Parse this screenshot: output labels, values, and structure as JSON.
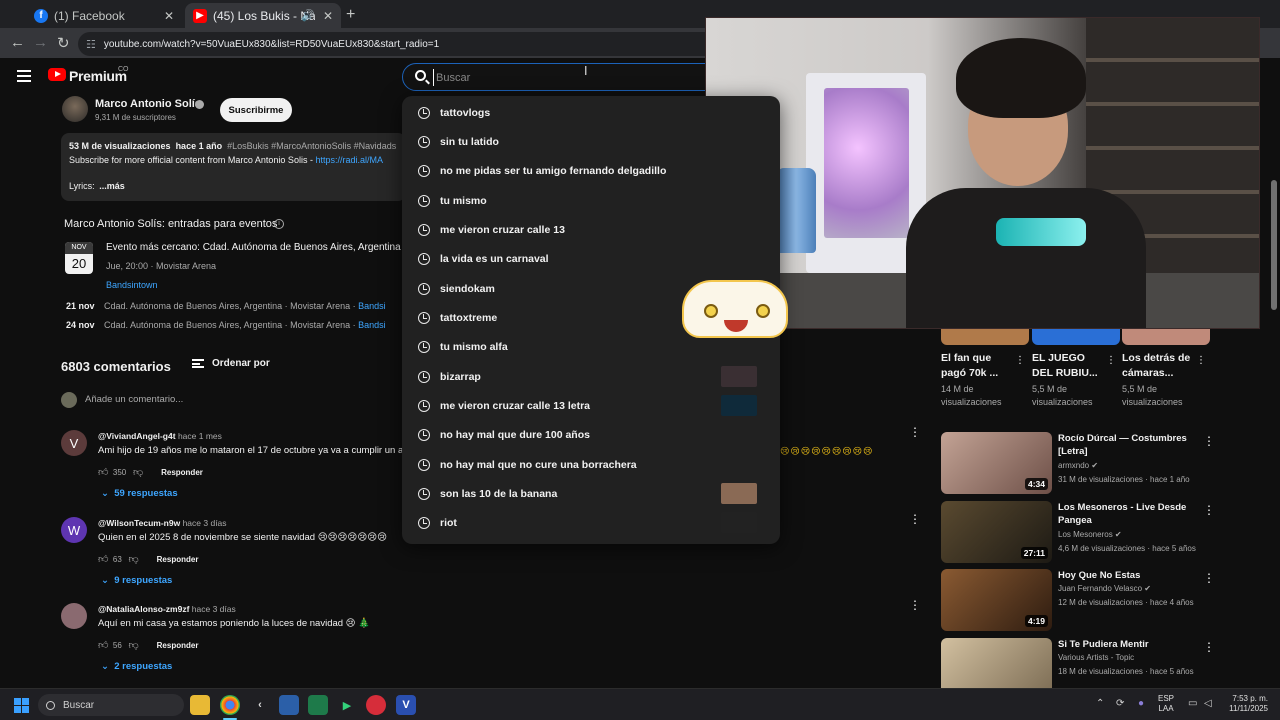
{
  "browser": {
    "tabs": [
      {
        "label": "(1) Facebook",
        "favicon": "facebook-icon",
        "active": false
      },
      {
        "label": "(45) Los Bukis - Navidad sin",
        "favicon": "youtube-icon",
        "active": true
      }
    ],
    "url": "youtube.com/watch?v=50VuaEUx830&list=RD50VuaEUx830&start_radio=1"
  },
  "youtube": {
    "brand": "Premium",
    "country_code": "CO",
    "search": {
      "placeholder": "Buscar",
      "value": ""
    },
    "accent": "#ff0000",
    "link_color": "#3ea6ff"
  },
  "channel": {
    "name": "Marco Antonio Solís",
    "subscribers": "9,31 M de suscriptores",
    "subscribe_label": "Suscribirme"
  },
  "description": {
    "views": "53 M de visualizaciones",
    "age": "hace 1 año",
    "hashtags": "#LosBukis #MarcoAntonioSolis #Navidads",
    "line2_prefix": "Subscribe for more official content from Marco Antonio Solis - ",
    "line2_link": "https://radi.al/MA",
    "lyrics": "Lyrics:",
    "more": "...más"
  },
  "events": {
    "title": "Marco Antonio Solís: entradas para eventos",
    "featured": {
      "month": "NOV",
      "day": "20",
      "name": "Evento más cercano: Cdad. Autónoma de Buenos Aires, Argentina",
      "time": "Jue, 20:00 · Movistar Arena",
      "source": "Bandsintown"
    },
    "rows": [
      {
        "date": "21 nov",
        "place": "Cdad. Autónoma de Buenos Aires, Argentina · Movistar Arena · ",
        "source": "Bandsi"
      },
      {
        "date": "24 nov",
        "place": "Cdad. Autónoma de Buenos Aires, Argentina · Movistar Arena · ",
        "source": "Bandsi"
      }
    ]
  },
  "comments_section": {
    "count": "6803 comentarios",
    "sort_label": "Ordenar por",
    "add_placeholder": "Añade un comentario...",
    "reply_label": "Responder",
    "items": [
      {
        "initial": "V",
        "avatar_color": "#5c3b3b",
        "handle": "@ViviandAngel-g4t",
        "ago": "hace 1 mes",
        "text": "Ami hijo de 19 años me lo mataron el 17 de octubre ya va a cumplir un añ",
        "likes": "350",
        "replies": "59 respuestas"
      },
      {
        "initial": "W",
        "avatar_color": "#5e35b1",
        "handle": "@WilsonTecum-n9w",
        "ago": "hace 3 días",
        "text": "Quien en el 2025 8 de noviembre se siente navidad 😢😢😢😢😢😢😢",
        "likes": "63",
        "replies": "9 respuestas"
      },
      {
        "initial": "",
        "avatar_color": "#8a6a70",
        "handle": "@NataliaAlonso-zm9zf",
        "ago": "hace 3 días",
        "text": "Aquí en mi casa ya estamos poniendo la luces de navidad 😢 🎄",
        "likes": "56",
        "replies": "2 respuestas"
      }
    ],
    "overflow_emojis": "😢😢😢😢😢😢😢😢😢"
  },
  "suggestions": [
    {
      "text": "tattovlogs",
      "thumb": ""
    },
    {
      "text": "sin tu latido",
      "thumb": ""
    },
    {
      "text": "no me pidas ser tu amigo fernando delgadillo",
      "thumb": ""
    },
    {
      "text": "tu mismo",
      "thumb": ""
    },
    {
      "text": "me vieron cruzar calle 13",
      "thumb": ""
    },
    {
      "text": "la vida es un carnaval",
      "thumb": ""
    },
    {
      "text": "siendokam",
      "thumb": ""
    },
    {
      "text": "tattoxtreme",
      "thumb": ""
    },
    {
      "text": "tu mismo alfa",
      "thumb": ""
    },
    {
      "text": "bizarrap",
      "thumb": "#3a2f33"
    },
    {
      "text": "me vieron cruzar calle 13 letra",
      "thumb": "#0f2a3a"
    },
    {
      "text": "no hay mal que dure 100 años",
      "thumb": ""
    },
    {
      "text": "no hay mal que no cure una borrachera",
      "thumb": ""
    },
    {
      "text": "son las 10 de la banana",
      "thumb": "#8a6a55"
    },
    {
      "text": "riot",
      "thumb": "#222222"
    }
  ],
  "shorts_cards": [
    {
      "title": "El fan que pagó 70k ...",
      "views": "14 M de visualizaciones",
      "color": "#b07a4a"
    },
    {
      "title": "EL JUEGO DEL RUBIU...",
      "views": "5,5 M de visualizaciones",
      "color": "#2a6fd6"
    },
    {
      "title": "Los detrás de cámaras...",
      "views": "5,5 M de visualizaciones",
      "color": "#c08a7a"
    }
  ],
  "related": [
    {
      "title": "Rocío Dúrcal — Costumbres [Letra]",
      "channel": "armxndo",
      "meta": "31 M de visualizaciones · hace 1 año",
      "duration": "4:34",
      "color": "#a0827a",
      "verified": true
    },
    {
      "title": "Los Mesoneros - Live Desde Pangea",
      "channel": "Los Mesoneros",
      "meta": "4,6 M de visualizaciones · hace 5 años",
      "duration": "27:11",
      "color": "#2f2a22",
      "verified": true
    },
    {
      "title": "Hoy Que No Estas",
      "channel": "Juan Fernando Velasco",
      "meta": "12 M de visualizaciones · hace 4 años",
      "duration": "4:19",
      "color": "#5a3a22",
      "verified": true
    },
    {
      "title": "Si Te Pudiera Mentir",
      "channel": "Various Artists - Topic",
      "meta": "18 M de visualizaciones · hace 5 años",
      "duration": "",
      "color": "#b9a58a",
      "verified": false
    }
  ],
  "taskbar": {
    "search_placeholder": "Buscar",
    "language": "ESP",
    "layout": "LAA",
    "time": "7:53 p. m.",
    "date": "11/11/2025"
  }
}
